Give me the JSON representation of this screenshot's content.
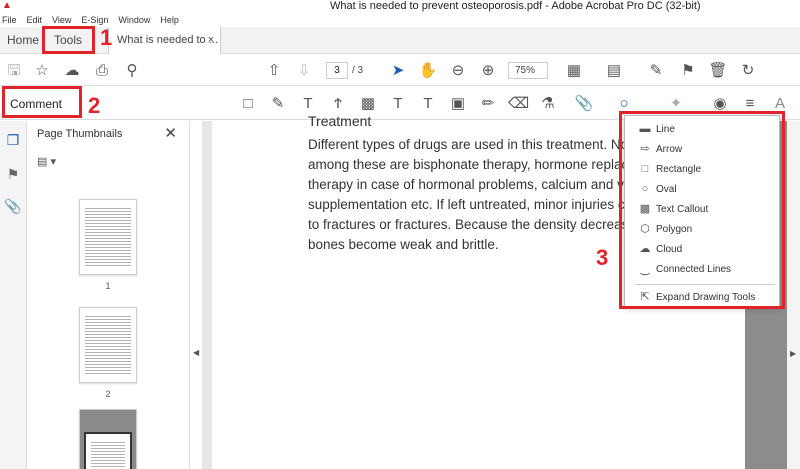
{
  "window": {
    "title": "What is needed to prevent osteoporosis.pdf - Adobe Acrobat Pro DC (32-bit)"
  },
  "menu": [
    "File",
    "Edit",
    "View",
    "E-Sign",
    "Window",
    "Help"
  ],
  "tabs": {
    "home": "Home",
    "tools": "Tools",
    "document": "What is needed to ...",
    "document_close": "×"
  },
  "toolbar": {
    "current_page": "3",
    "total_pages": "/ 3",
    "zoom": "75%"
  },
  "comment_toolbar": {
    "label": "Comment"
  },
  "thumbnails": {
    "title": "Page Thumbnails",
    "close": "✕",
    "pages": [
      "1",
      "2"
    ]
  },
  "document": {
    "heading": "Treatment",
    "paragraph": "Different types of drugs are used in this treatment. No\namong these are bisphonate therapy, hormone replac\ntherapy in case of hormonal problems, calcium and vit\nsupplementation etc. If left untreated, minor injuries c\nto fractures or fractures. Because the density decrease\nbones become weak and brittle."
  },
  "drawing_menu": {
    "items": [
      "Line",
      "Arrow",
      "Rectangle",
      "Oval",
      "Text Callout",
      "Polygon",
      "Cloud",
      "Connected Lines"
    ],
    "expand": "Expand Drawing Tools"
  },
  "annotations": {
    "n1": "1",
    "n2": "2",
    "n3": "3",
    "color": "#e3232a"
  }
}
